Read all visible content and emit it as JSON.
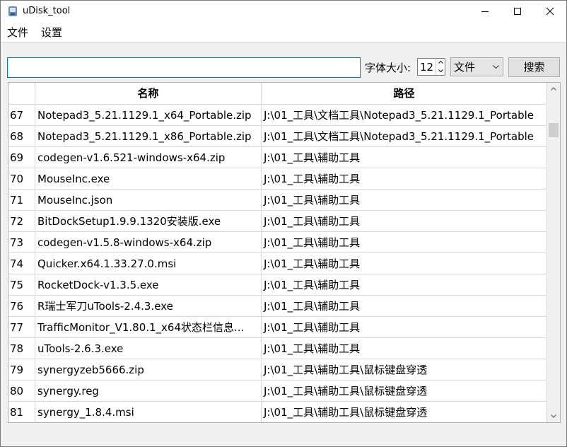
{
  "window": {
    "title": "uDisk_tool",
    "icon": "usb-drive-icon"
  },
  "menu": {
    "file": "文件",
    "settings": "设置"
  },
  "toolbar": {
    "search_value": "",
    "font_size_label": "字体大小:",
    "font_size_value": "12",
    "type_selected": "文件",
    "search_button": "搜索"
  },
  "table": {
    "columns": [
      "名称",
      "路径"
    ],
    "rows": [
      {
        "num": "67",
        "name": "Notepad3_5.21.1129.1_x64_Portable.zip",
        "path": "J:\\01_工具\\文档工具\\Notepad3_5.21.1129.1_Portable"
      },
      {
        "num": "68",
        "name": "Notepad3_5.21.1129.1_x86_Portable.zip",
        "path": "J:\\01_工具\\文档工具\\Notepad3_5.21.1129.1_Portable"
      },
      {
        "num": "69",
        "name": "codegen-v1.6.521-windows-x64.zip",
        "path": "J:\\01_工具\\辅助工具"
      },
      {
        "num": "70",
        "name": "MouseInc.exe",
        "path": "J:\\01_工具\\辅助工具"
      },
      {
        "num": "71",
        "name": "MouseInc.json",
        "path": "J:\\01_工具\\辅助工具"
      },
      {
        "num": "72",
        "name": "BitDockSetup1.9.9.1320安装版.exe",
        "path": "J:\\01_工具\\辅助工具"
      },
      {
        "num": "73",
        "name": "codegen-v1.5.8-windows-x64.zip",
        "path": "J:\\01_工具\\辅助工具"
      },
      {
        "num": "74",
        "name": "Quicker.x64.1.33.27.0.msi",
        "path": "J:\\01_工具\\辅助工具"
      },
      {
        "num": "75",
        "name": "RocketDock-v1.3.5.exe",
        "path": "J:\\01_工具\\辅助工具"
      },
      {
        "num": "76",
        "name": "R瑞士军刀uTools-2.4.3.exe",
        "path": "J:\\01_工具\\辅助工具"
      },
      {
        "num": "77",
        "name": "TrafficMonitor_V1.80.1_x64状态栏信息...",
        "path": "J:\\01_工具\\辅助工具"
      },
      {
        "num": "78",
        "name": "uTools-2.6.3.exe",
        "path": "J:\\01_工具\\辅助工具"
      },
      {
        "num": "79",
        "name": "synergyzeb5666.zip",
        "path": "J:\\01_工具\\辅助工具\\鼠标键盘穿透"
      },
      {
        "num": "80",
        "name": "synergy.reg",
        "path": "J:\\01_工具\\辅助工具\\鼠标键盘穿透"
      },
      {
        "num": "81",
        "name": "synergy_1.8.4.msi",
        "path": "J:\\01_工具\\辅助工具\\鼠标键盘穿透"
      }
    ]
  },
  "colors": {
    "input_focus_border": "#0078d7",
    "grid_line": "#d8d8d8",
    "window_bg": "#f0f0f0"
  }
}
